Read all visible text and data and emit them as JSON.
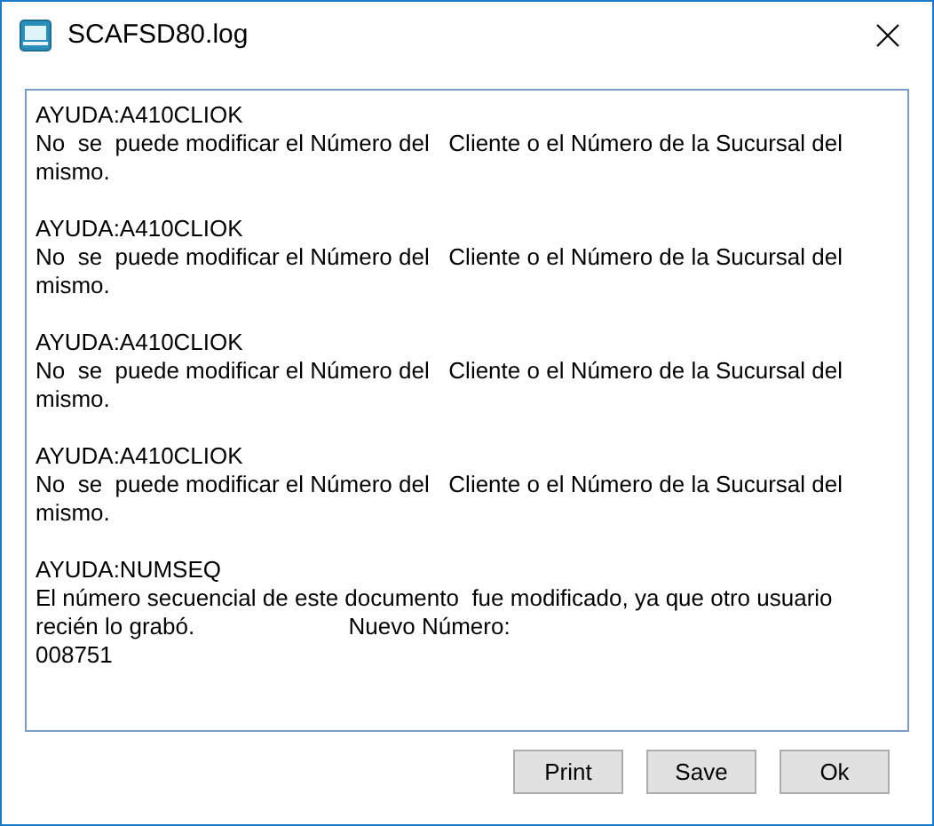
{
  "window": {
    "title": "SCAFSD80.log"
  },
  "log": [
    {
      "code": "AYUDA:A410CLIOK",
      "message": "No  se  puede modificar el Número del   Cliente o el Número de la Sucursal del mismo."
    },
    {
      "code": "AYUDA:A410CLIOK",
      "message": "No  se  puede modificar el Número del   Cliente o el Número de la Sucursal del mismo."
    },
    {
      "code": "AYUDA:A410CLIOK",
      "message": "No  se  puede modificar el Número del   Cliente o el Número de la Sucursal del mismo."
    },
    {
      "code": "AYUDA:A410CLIOK",
      "message": "No  se  puede modificar el Número del   Cliente o el Número de la Sucursal del mismo."
    },
    {
      "code": "AYUDA:NUMSEQ",
      "message": "El número secuencial de este documento  fue modificado, ya que otro usuario recién lo grabó.                        Nuevo Número:\n008751"
    }
  ],
  "buttons": [
    "Print",
    "Save",
    "Ok"
  ]
}
